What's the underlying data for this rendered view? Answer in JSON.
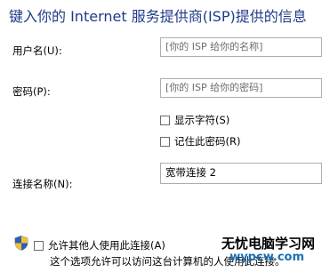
{
  "header": {
    "title": "键入你的 Internet 服务提供商(ISP)提供的信息"
  },
  "form": {
    "username_label": "用户名(U):",
    "username_placeholder": "[你的 ISP 给你的名称]",
    "password_label": "密码(P):",
    "password_placeholder": "[你的 ISP 给你的密码]",
    "show_chars_label": "显示字符(S)",
    "remember_password_label": "记住此密码(R)",
    "connection_name_label": "连接名称(N):",
    "connection_name_value": "宽带连接 2"
  },
  "sharing": {
    "allow_others_label": "允许其他人使用此连接(A)",
    "description": "这个选项允许可以访问这台计算机的人使用此连接。"
  },
  "watermark": {
    "line1": "无忧电脑学习网",
    "line2": "wypcw.com"
  },
  "icons": {
    "shield": "uac-shield-icon"
  },
  "colors": {
    "title": "#1f3a8a",
    "input_border": "#abadb3",
    "placeholder": "#6d6d6d"
  }
}
